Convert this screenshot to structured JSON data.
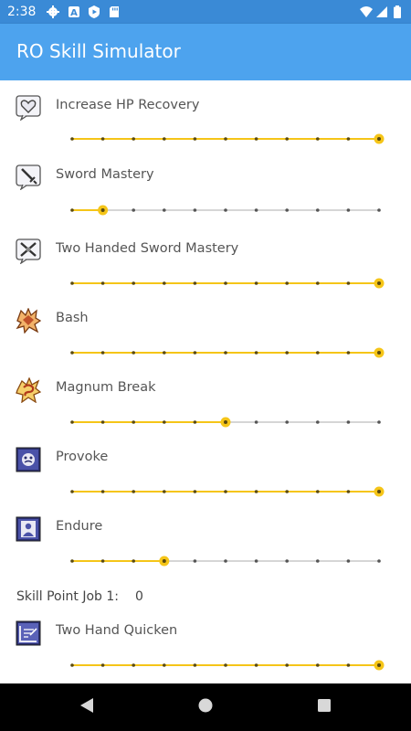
{
  "status_bar": {
    "time": "2:38",
    "icons": [
      "settings-icon",
      "a-icon",
      "play-protect-icon",
      "sd-card-icon",
      "wifi-icon",
      "signal-icon",
      "battery-icon"
    ]
  },
  "app_bar": {
    "title": "RO Skill Simulator"
  },
  "colors": {
    "accent": "#f5c518",
    "appbar": "#4da3ee",
    "statusbar": "#3a8ad6",
    "track_inactive": "#d6d6d6",
    "tick": "#555555"
  },
  "skills": [
    {
      "name": "Increase HP Recovery",
      "icon": "heart-icon",
      "level": 10,
      "max": 10
    },
    {
      "name": "Sword Mastery",
      "icon": "sword-icon",
      "level": 1,
      "max": 10
    },
    {
      "name": "Two Handed Sword Mastery",
      "icon": "crossed-swords-icon",
      "level": 10,
      "max": 10
    },
    {
      "name": "Bash",
      "icon": "bash-icon",
      "level": 10,
      "max": 10
    },
    {
      "name": "Magnum Break",
      "icon": "magnum-break-icon",
      "level": 5,
      "max": 10
    },
    {
      "name": "Provoke",
      "icon": "provoke-icon",
      "level": 10,
      "max": 10
    },
    {
      "name": "Endure",
      "icon": "endure-icon",
      "level": 3,
      "max": 10
    }
  ],
  "skill_points": {
    "label": "Skill Point Job 1:",
    "value": "0"
  },
  "skills_job2": [
    {
      "name": "Two Hand Quicken",
      "icon": "two-hand-quicken-icon",
      "level": 10,
      "max": 10
    }
  ],
  "nav": {
    "back": "back-icon",
    "home": "home-icon",
    "recents": "recents-icon"
  }
}
